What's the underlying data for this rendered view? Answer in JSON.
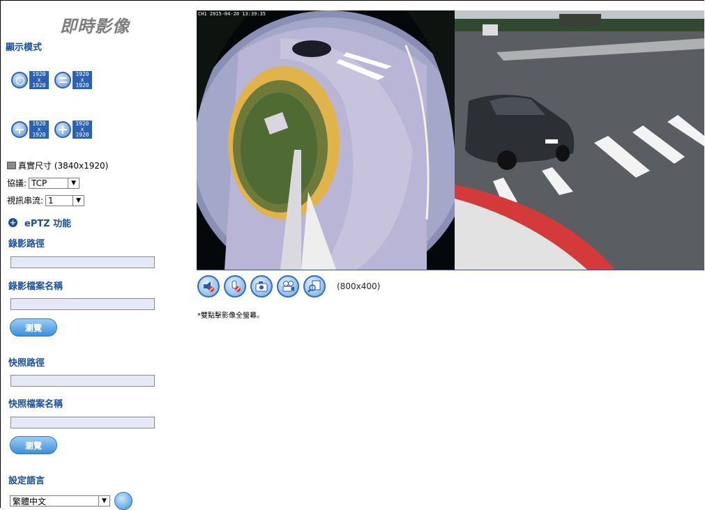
{
  "header": {
    "title": "即時影像"
  },
  "display_mode": {
    "label": "顯示模式",
    "modes": [
      {
        "icon": "single-view-icon",
        "resolution": [
          "1920",
          "x",
          "1920"
        ]
      },
      {
        "icon": "panorama-view-icon",
        "resolution": [
          "1920",
          "x",
          "1920"
        ]
      },
      {
        "icon": "dual-view-icon",
        "resolution": [
          "1920",
          "x",
          "1920"
        ]
      },
      {
        "icon": "quad-view-icon",
        "resolution": [
          "1920",
          "x",
          "1920"
        ]
      }
    ]
  },
  "actual_size": {
    "label": "真實尺寸 (3840x1920)"
  },
  "protocol": {
    "label": "協議:",
    "value": "TCP"
  },
  "stream": {
    "label": "視訊串流:",
    "value": "1"
  },
  "eptz": {
    "label": "ePTZ 功能"
  },
  "record_path": {
    "label": "錄影路徑",
    "value": ""
  },
  "record_filename": {
    "label": "錄影檔案名稱",
    "value": "",
    "browse": "瀏覽"
  },
  "snapshot_path": {
    "label": "快照路徑",
    "value": ""
  },
  "snapshot_filename": {
    "label": "快照檔案名稱",
    "value": "",
    "browse": "瀏覽"
  },
  "language": {
    "label": "設定語言",
    "value": "繁體中文"
  },
  "video": {
    "timestamp": "CH1 2015-04-20 13:39:35"
  },
  "controls": {
    "buttons": [
      "mute-audio-icon",
      "mute-mic-icon",
      "snapshot-icon",
      "record-icon",
      "zoom-icon"
    ],
    "resolution": "(800x400)"
  },
  "note": "*雙點擊影像全螢幕。",
  "colors": {
    "accent": "#1a4fa0",
    "button": "#3b8fdc"
  }
}
